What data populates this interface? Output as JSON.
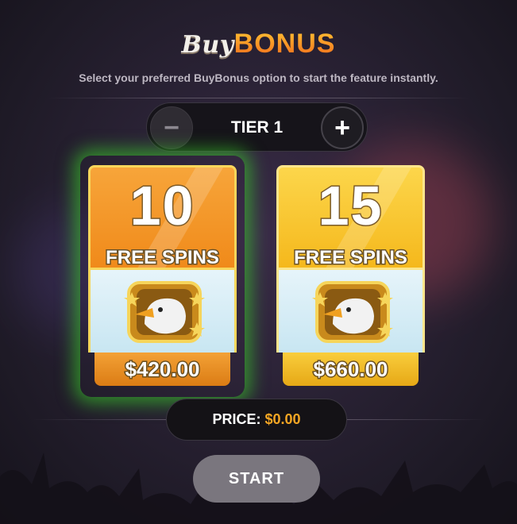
{
  "header": {
    "title_script": "Buy",
    "title_bold": "BONUS",
    "subtitle": "Select your preferred BuyBonus option to start the feature instantly."
  },
  "tier_selector": {
    "label": "TIER 1",
    "decrease_symbol": "−",
    "increase_symbol": "+"
  },
  "options": [
    {
      "spins": "10",
      "caption": "FREE SPINS",
      "price": "$420.00",
      "selected": true,
      "icon": "eagle-badge-icon",
      "accent": "#f08a1a"
    },
    {
      "spins": "15",
      "caption": "FREE SPINS",
      "price": "$660.00",
      "selected": false,
      "icon": "eagle-badge-icon",
      "accent": "#f5b81c"
    }
  ],
  "price_bar": {
    "label": "PRICE:",
    "amount": "$0.00"
  },
  "start_label": "START",
  "colors": {
    "selected_glow": "#3ce628",
    "price_accent": "#f5a623"
  }
}
